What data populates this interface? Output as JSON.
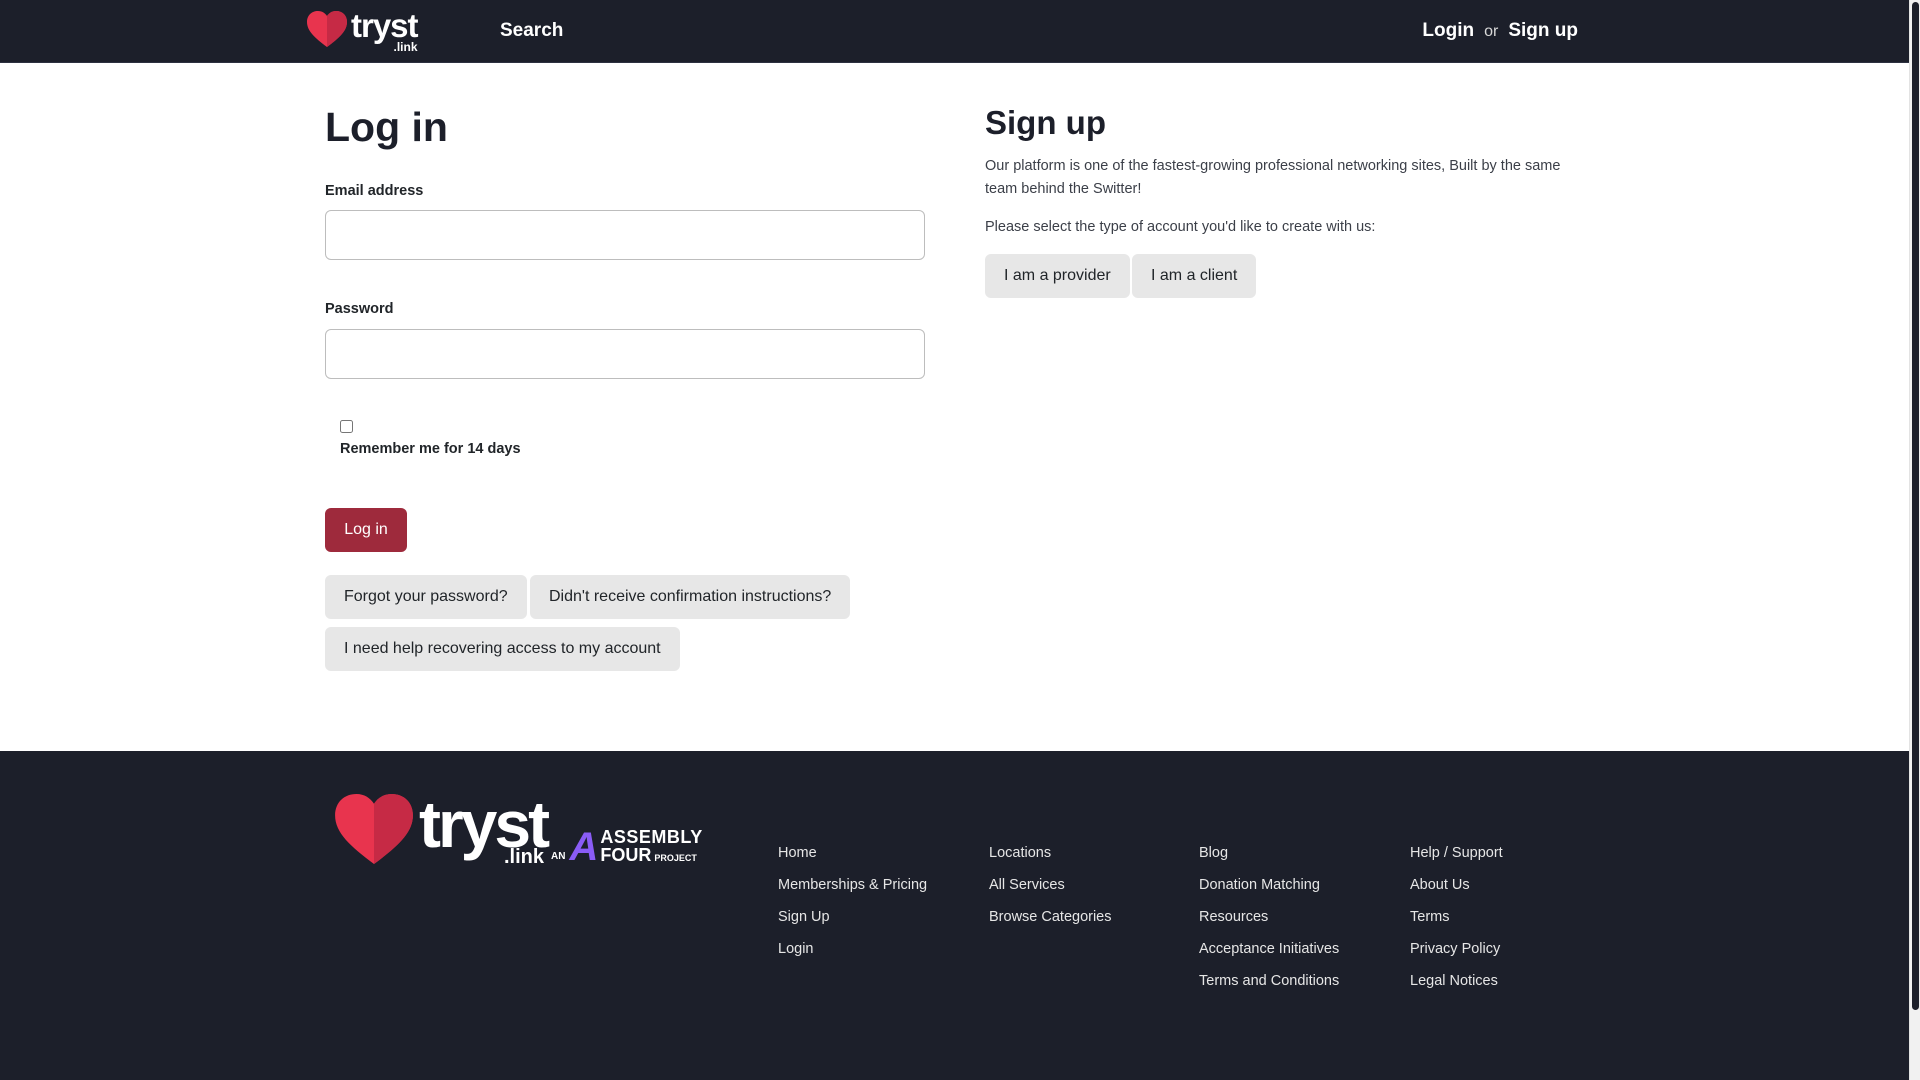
{
  "header": {
    "logo_word": "tryst",
    "logo_suffix": ".link",
    "search_label": "Search",
    "login_label": "Login",
    "or_label": "or",
    "signup_label": "Sign up"
  },
  "login": {
    "heading": "Log in",
    "email_label": "Email address",
    "email_value": "",
    "password_label": "Password",
    "password_value": "",
    "remember_label": "Remember me for 14 days",
    "submit_label": "Log in",
    "forgot_label": "Forgot your password?",
    "confirmation_label": "Didn't receive confirmation instructions?",
    "recover_label": "I need help recovering access to my account"
  },
  "signup": {
    "heading": "Sign up",
    "description": "Our platform is one of the fastest-growing professional networking sites, Built by the same team behind the Switter!",
    "prompt": "Please select the type of account you'd like to create with us:",
    "provider_label": "I am a provider",
    "client_label": "I am a client"
  },
  "footer": {
    "logo_word": "tryst",
    "logo_suffix": ".link",
    "assembly_an": "AN",
    "assembly_a": "A",
    "assembly_line1": "ASSEMBLY",
    "assembly_line2": "FOUR",
    "assembly_project": "PROJECT",
    "columns": [
      [
        "Home",
        "Memberships & Pricing",
        "Sign Up",
        "Login"
      ],
      [
        "Locations",
        "All Services",
        "Browse Categories"
      ],
      [
        "Blog",
        "Donation Matching",
        "Resources",
        "Acceptance Initiatives",
        "Terms and Conditions"
      ],
      [
        "Help / Support",
        "About Us",
        "Terms",
        "Privacy Policy",
        "Legal Notices"
      ]
    ]
  },
  "colors": {
    "header_bg": "#1c1f2a",
    "heart_red": "#e8344e",
    "primary_button": "#9e2a3c",
    "secondary_button": "#e7e7e7",
    "assembly_accent": "#8a5cf6"
  }
}
